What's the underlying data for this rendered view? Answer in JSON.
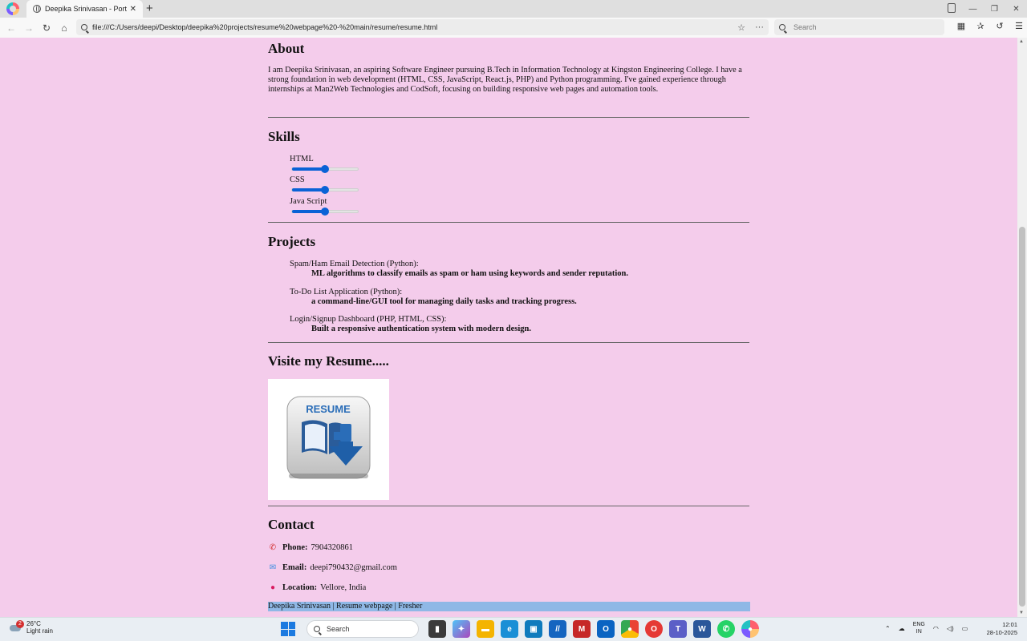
{
  "browser": {
    "tab_title": "Deepika Srinivasan - Portfolio",
    "url": "file:///C:/Users/deepi/Desktop/deepika%20projects/resume%20webpage%20-%20main/resume/resume.html",
    "search_placeholder": "Search"
  },
  "page": {
    "about": {
      "title": "About",
      "text": "I am Deepika Srinivasan, an aspiring Software Engineer pursuing B.Tech in Information Technology at Kingston Engineering College. I have a strong foundation in web development (HTML, CSS, JavaScript, React.js, PHP) and Python programming. I've gained experience through internships at Man2Web Technologies and CodSoft, focusing on building responsive web pages and automation tools."
    },
    "skills": {
      "title": "Skills",
      "items": [
        {
          "label": "HTML",
          "value": 0.5
        },
        {
          "label": "CSS",
          "value": 0.5
        },
        {
          "label": "Java Script",
          "value": 0.5
        }
      ]
    },
    "projects": {
      "title": "Projects",
      "items": [
        {
          "name": "Spam/Ham Email Detection (Python):",
          "desc": "ML algorithms to classify emails as spam or ham using keywords and sender reputation."
        },
        {
          "name": "To-Do List Application (Python):",
          "desc": "a command-line/GUI tool for managing daily tasks and tracking progress."
        },
        {
          "name": "Login/Signup Dashboard (PHP, HTML, CSS):",
          "desc": "Built a responsive authentication system with modern design."
        }
      ]
    },
    "resume": {
      "title": "Visite my Resume.....",
      "image_text": "RESUME"
    },
    "contact": {
      "title": "Contact",
      "phone_label": "Phone:",
      "phone": "7904320861",
      "email_label": "Email:",
      "email": "deepi790432@gmail.com",
      "location_label": "Location:",
      "location": "Vellore, India"
    },
    "footer": "Deepika Srinivasan | Resume webpage | Fresher"
  },
  "taskbar": {
    "temperature": "26°C",
    "weather": "Light rain",
    "weather_badge": "2",
    "search": "Search",
    "lang_1": "ENG",
    "lang_2": "IN",
    "time": "12:01",
    "date": "28-10-2025"
  },
  "colors": {
    "page_background": "#f4cceb",
    "footer_background": "#8fb8e6",
    "slider_accent": "#0a62d6"
  }
}
